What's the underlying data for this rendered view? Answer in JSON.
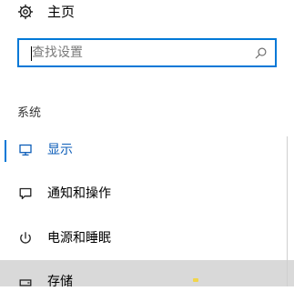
{
  "home": {
    "label": "主页",
    "icon": "gear-icon"
  },
  "search": {
    "placeholder": "查找设置",
    "icon": "search-icon"
  },
  "section": {
    "title": "系统"
  },
  "nav": {
    "items": [
      {
        "label": "显示",
        "icon": "monitor-icon",
        "selected": true
      },
      {
        "label": "通知和操作",
        "icon": "chat-bubble-icon",
        "selected": false
      },
      {
        "label": "电源和睡眠",
        "icon": "power-icon",
        "selected": false
      },
      {
        "label": "存储",
        "icon": "storage-drive-icon",
        "selected": false,
        "hovered": true
      }
    ]
  },
  "colors": {
    "accent": "#0078d7",
    "selected_text": "#0c5db8",
    "hover_background": "#d9d9d9"
  }
}
